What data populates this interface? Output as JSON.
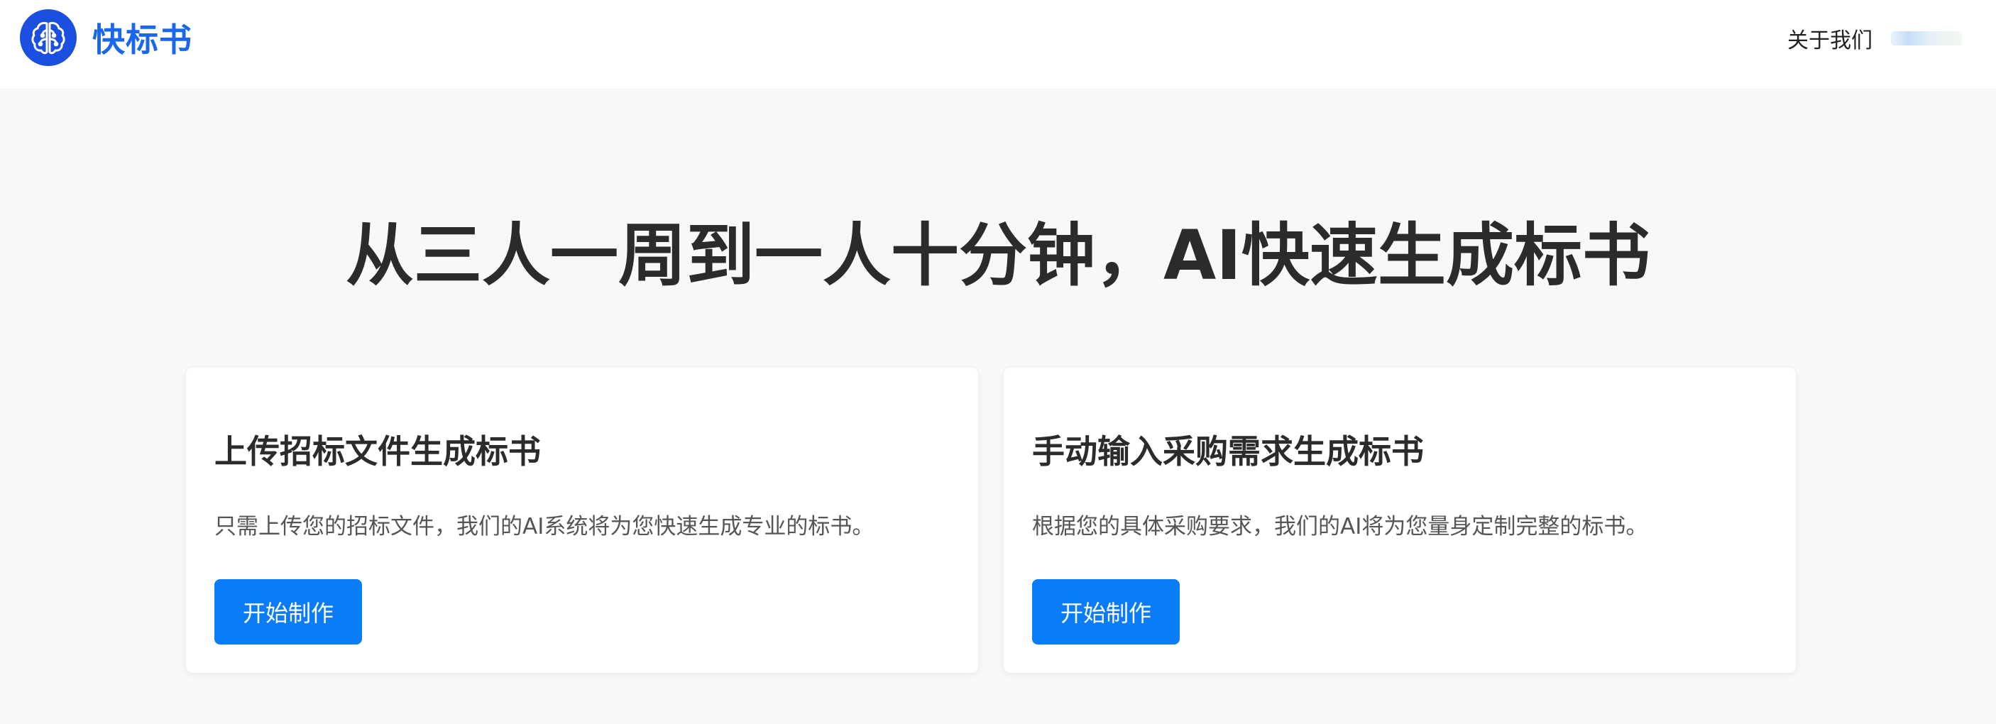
{
  "header": {
    "brand_name": "快标书",
    "logo_icon": "brain-icon",
    "nav_about": "关于我们",
    "brand_color": "#1a66ec",
    "logo_bg_color": "#1a4fe0"
  },
  "hero": {
    "title": "从三人一周到一人十分钟，AI快速生成标书"
  },
  "cards": [
    {
      "title": "上传招标文件生成标书",
      "description": "只需上传您的招标文件，我们的AI系统将为您快速生成专业的标书。",
      "button_label": "开始制作"
    },
    {
      "title": "手动输入采购需求生成标书",
      "description": "根据您的具体采购要求，我们的AI将为您量身定制完整的标书。",
      "button_label": "开始制作"
    }
  ],
  "colors": {
    "accent": "#0a7cf7",
    "page_bg": "#f8f8f8",
    "card_bg": "#ffffff"
  }
}
